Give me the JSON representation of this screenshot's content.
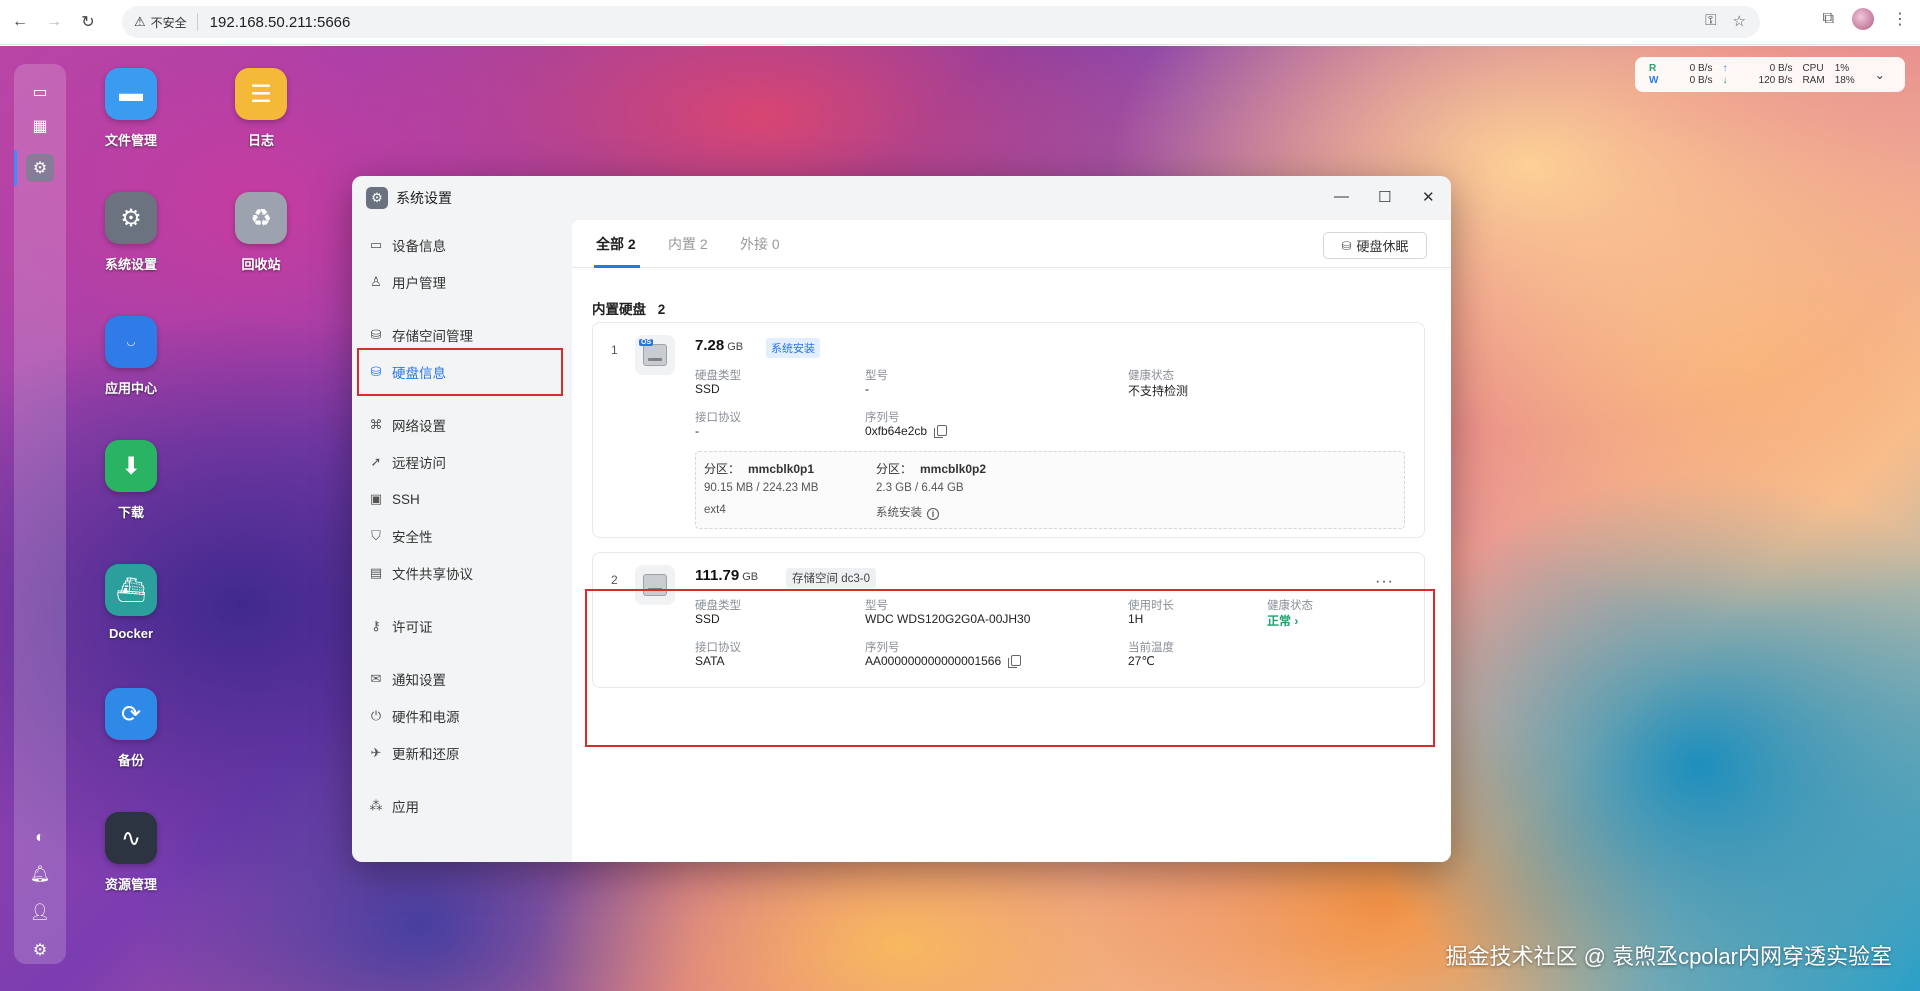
{
  "browser": {
    "security_label": "不安全",
    "url": "192.168.50.211:5666"
  },
  "net_widget": {
    "read_label": "R",
    "write_label": "W",
    "r_down": "0 B/s",
    "w_down": "0 B/s",
    "r_up": "0 B/s",
    "w_up": "120 B/s",
    "cpu_label": "CPU",
    "ram_label": "RAM",
    "cpu_value": "1%",
    "ram_value": "18%"
  },
  "desktop_apps": [
    {
      "label": "文件管理",
      "icon": "folder-icon",
      "color": "#3b9bf0"
    },
    {
      "label": "日志",
      "icon": "log-icon",
      "color": "#f5b93a"
    },
    {
      "label": "系统设置",
      "icon": "gear-icon",
      "color": "#6b7280"
    },
    {
      "label": "回收站",
      "icon": "recycle-icon",
      "color": "#9ca3af"
    },
    {
      "label": "应用中心",
      "icon": "store-icon",
      "color": "#2f7be8"
    },
    {
      "label": "下载",
      "icon": "download-icon",
      "color": "#28b463"
    },
    {
      "label": "Docker",
      "icon": "docker-icon",
      "color": "#2a9f9b"
    },
    {
      "label": "备份",
      "icon": "backup-icon",
      "color": "#2e8ae6"
    },
    {
      "label": "资源管理",
      "icon": "monitor-icon",
      "color": "#2b3440"
    }
  ],
  "window": {
    "title": "系统设置",
    "sidebar": [
      {
        "label": "设备信息",
        "icon": "device-icon"
      },
      {
        "label": "用户管理",
        "icon": "user-icon"
      },
      {
        "label": "存储空间管理",
        "icon": "storage-icon"
      },
      {
        "label": "硬盘信息",
        "icon": "disk-icon",
        "active": true
      },
      {
        "label": "网络设置",
        "icon": "network-icon"
      },
      {
        "label": "远程访问",
        "icon": "remote-icon"
      },
      {
        "label": "SSH",
        "icon": "ssh-icon"
      },
      {
        "label": "安全性",
        "icon": "shield-icon"
      },
      {
        "label": "文件共享协议",
        "icon": "file-share-icon"
      },
      {
        "label": "许可证",
        "icon": "key-icon"
      },
      {
        "label": "通知设置",
        "icon": "mail-icon"
      },
      {
        "label": "硬件和电源",
        "icon": "power-icon"
      },
      {
        "label": "更新和还原",
        "icon": "update-icon"
      },
      {
        "label": "应用",
        "icon": "apps-icon"
      }
    ],
    "tabs": {
      "all": "全部 2",
      "internal": "内置 2",
      "external": "外接 0"
    },
    "sleep_button": "硬盘休眠",
    "section_title": "内置硬盘",
    "section_count": "2",
    "disks": [
      {
        "index": "1",
        "os_badge": "OS",
        "size": "7.28",
        "unit": "GB",
        "tag": "系统安装",
        "type_label": "硬盘类型",
        "type_value": "SSD",
        "model_label": "型号",
        "model_value": "-",
        "health_label": "健康状态",
        "health_value": "不支持检测",
        "iface_label": "接口协议",
        "iface_value": "-",
        "serial_label": "序列号",
        "serial_value": "0xfb64e2cb",
        "partitions": [
          {
            "label": "分区：",
            "name": "mmcblk0p1",
            "usage": "90.15 MB / 224.23 MB",
            "fs": "ext4"
          },
          {
            "label": "分区：",
            "name": "mmcblk0p2",
            "usage": "2.3 GB / 6.44 GB",
            "fs": "系统安装"
          }
        ]
      },
      {
        "index": "2",
        "size": "111.79",
        "unit": "GB",
        "tag": "存储空间 dc3-0",
        "type_label": "硬盘类型",
        "type_value": "SSD",
        "model_label": "型号",
        "model_value": "WDC WDS120G2G0A-00JH30",
        "uptime_label": "使用时长",
        "uptime_value": "1H",
        "health_label": "健康状态",
        "health_value": "正常",
        "iface_label": "接口协议",
        "iface_value": "SATA",
        "serial_label": "序列号",
        "serial_value": "AA000000000000001566",
        "temp_label": "当前温度",
        "temp_value": "27℃"
      }
    ]
  },
  "watermark": "掘金技术社区 @ 袁煦丞cpolar内网穿透实验室"
}
